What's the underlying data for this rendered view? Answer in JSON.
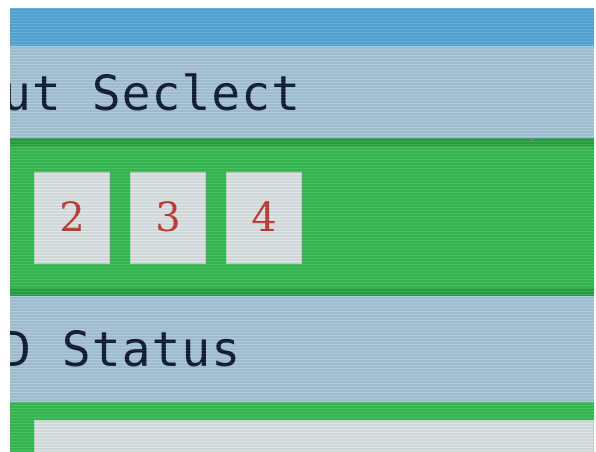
{
  "input_select": {
    "title": "ut Seclect",
    "buttons": [
      {
        "label": "2"
      },
      {
        "label": "3"
      },
      {
        "label": "4"
      }
    ]
  },
  "status": {
    "title": "D Status"
  },
  "colors": {
    "header_bg": "#a8c6d8",
    "row_bg": "#39bd53",
    "banner_bg": "#57a9d9",
    "button_bg": "#dde4e3",
    "button_text": "#c23a36",
    "title_text": "#0f1c33"
  }
}
